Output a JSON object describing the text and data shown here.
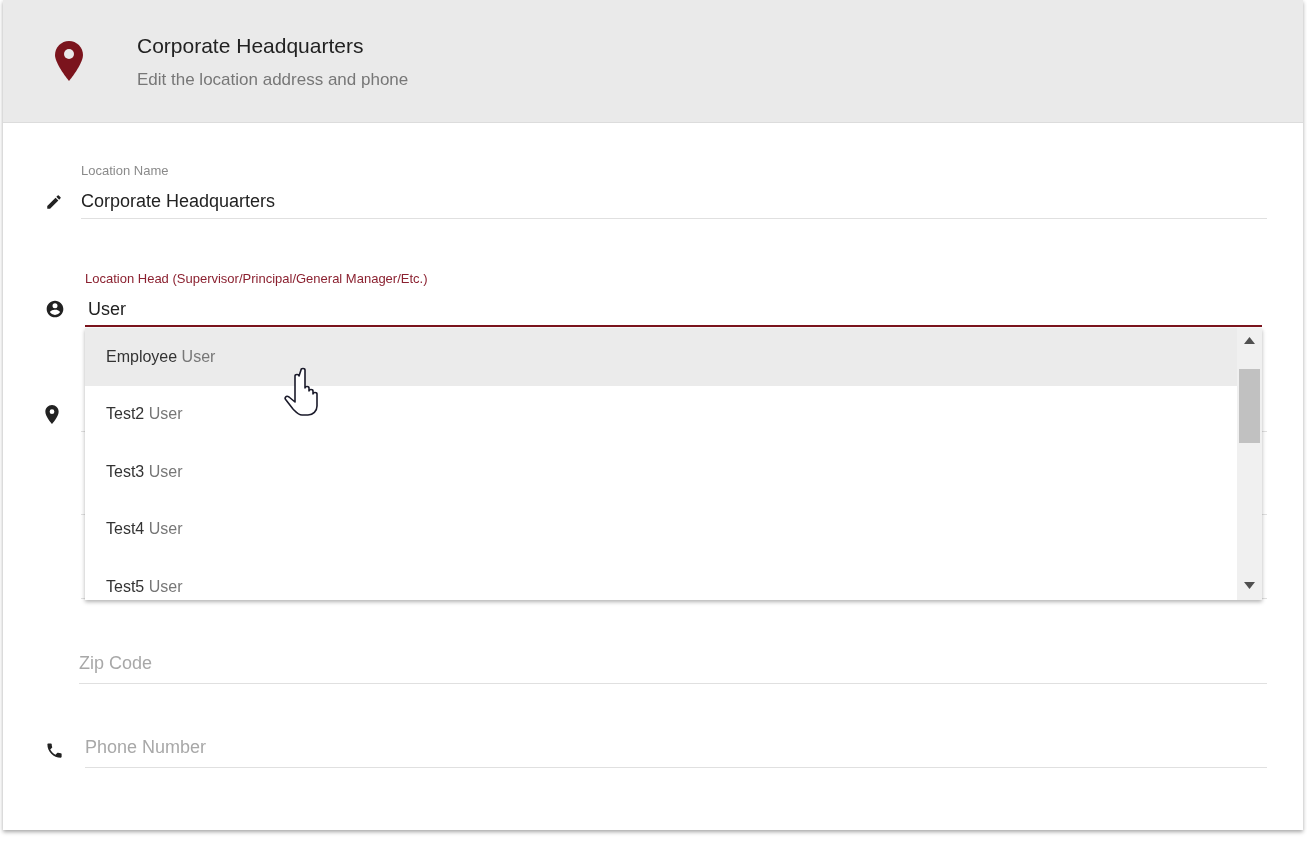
{
  "header": {
    "title": "Corporate Headquarters",
    "subtitle": "Edit the location address and phone"
  },
  "fields": [
    {
      "kind": "name",
      "label": "Location Name",
      "value": "Corporate Headquarters",
      "focused": false
    },
    {
      "kind": "person",
      "label": "Location Head (Supervisor/Principal/General Manager/Etc.)",
      "value": "User",
      "focused": true
    },
    {
      "kind": "address"
    },
    {
      "kind": "blank"
    },
    {
      "kind": "split"
    },
    {
      "kind": "plain",
      "placeholder": "Zip Code"
    },
    {
      "kind": "phone",
      "placeholder": "Phone Number"
    }
  ],
  "dropdown": {
    "options": [
      {
        "name": "Employee",
        "match": "User",
        "highlighted": true
      },
      {
        "name": "Test2",
        "match": "User",
        "highlighted": false
      },
      {
        "name": "Test3",
        "match": "User",
        "highlighted": false
      },
      {
        "name": "Test4",
        "match": "User",
        "highlighted": false
      },
      {
        "name": "Test5",
        "match": "User",
        "highlighted": false
      }
    ]
  }
}
